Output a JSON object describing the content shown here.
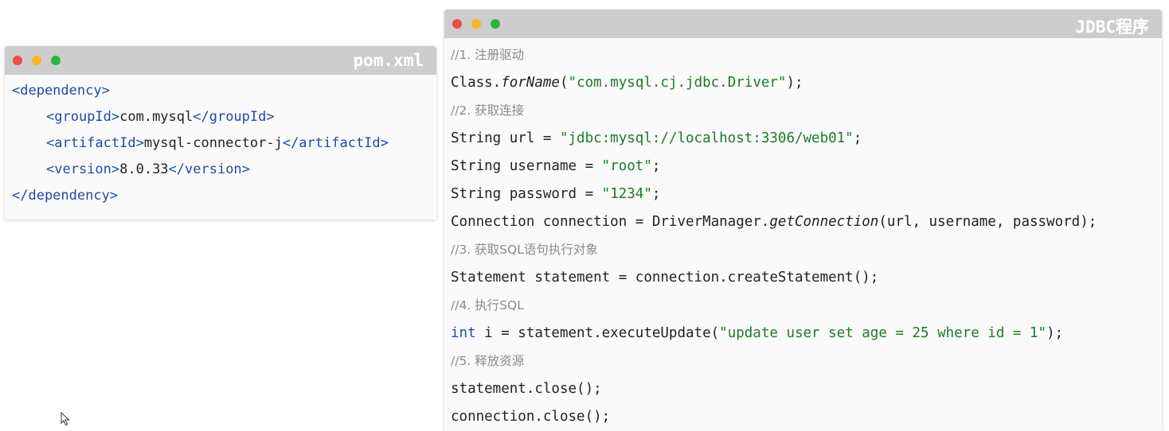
{
  "pom_window": {
    "title": "pom.xml",
    "lines": {
      "l1_open": "<dependency>",
      "l2_open": "<groupId>",
      "l2_val": "com.mysql",
      "l2_close": "</groupId>",
      "l3_open": "<artifactId>",
      "l3_val": "mysql-connector-j",
      "l3_close": "</artifactId>",
      "l4_open": "<version>",
      "l4_val": "8.0.33",
      "l4_close": "</version>",
      "l5_close": "</dependency>"
    }
  },
  "jdbc_window": {
    "title": "JDBC程序",
    "c1": "//1. 注册驱动",
    "l1a": "Class.",
    "l1b": "forName",
    "l1c": "(",
    "l1d": "\"com.mysql.cj.jdbc.Driver\"",
    "l1e": ");",
    "c2": "//2. 获取连接",
    "l2a": "String url = ",
    "l2b": "\"jdbc:mysql://localhost:3306/web01\"",
    "l2c": ";",
    "l3a": "String username = ",
    "l3b": "\"root\"",
    "l3c": ";",
    "l4a": "String password = ",
    "l4b": "\"1234\"",
    "l4c": ";",
    "l5a": "Connection connection = DriverManager.",
    "l5b": "getConnection",
    "l5c": "(url, username, password);",
    "c3": "//3. 获取SQL语句执行对象",
    "l6": "Statement statement = connection.createStatement();",
    "c4": "//4. 执行SQL",
    "l7a": "int",
    "l7b": " i = statement.executeUpdate(",
    "l7c": "\"update user set age = 25 where id = 1\"",
    "l7d": ");",
    "c5": "//5. 释放资源",
    "l8": "statement.close();",
    "l9": "connection.close();"
  }
}
